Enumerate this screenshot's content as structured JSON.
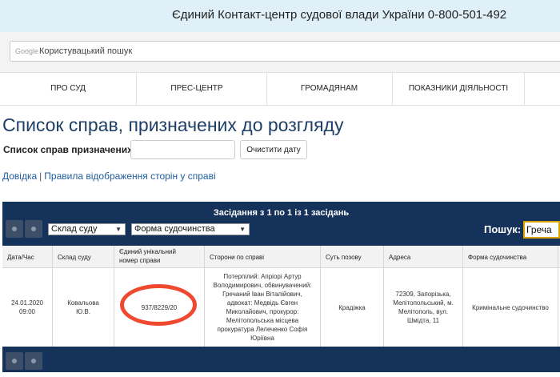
{
  "header": {
    "title": "Єдиний Контакт-центр судової влади України 0-800-501-492"
  },
  "google_search": {
    "logo_text": "Google",
    "placeholder": "Користувацький пошук"
  },
  "nav": {
    "items": [
      {
        "label": "ПРО СУД"
      },
      {
        "label": "ПРЕС-ЦЕНТР"
      },
      {
        "label": "ГРОМАДЯНАМ"
      },
      {
        "label": "ПОКАЗНИКИ ДІЯЛЬНОСТІ"
      }
    ]
  },
  "page": {
    "title": "Список справ, призначених до розгляду",
    "date_label": "Список справ призначених на",
    "date_value": "",
    "clear_date_button": "Очистити дату",
    "links": [
      "Довідка",
      "Правила відображення сторін у справі"
    ]
  },
  "hearings": {
    "count_text": "Засідання з 1 по 1 із 1 засідань",
    "filters": {
      "court_composition": "Склад суду",
      "proceeding_form": "Форма судочинства"
    },
    "search_label": "Пошук:",
    "search_value": "Греча",
    "columns": {
      "date": "Дата/Час",
      "court": "Склад суду",
      "case_number_1": "Єдиний унікальний",
      "case_number_2": "номер справи",
      "parties": "Сторони по справі",
      "claim": "Суть позову",
      "address": "Адреса",
      "form": "Форма судочинства"
    },
    "rows": [
      {
        "date": "24.01.2020",
        "time": "09:00",
        "court_1": "Ковальова",
        "court_2": "Ю.В.",
        "case_number": "937/8229/20",
        "parties": [
          "Потерпілий: Апріорі Артур",
          "Володимирович, обвинувачений:",
          "Гречаний Іван Віталійович,",
          "адвокат: Медвідь Євген",
          "Миколайович, прокурор:",
          "Мелітопольська місцева",
          "прокуратура Лелеченко Софія",
          "Юріївна"
        ],
        "claim": "Крадіжка",
        "address": [
          "72309, Запорізька,",
          "Мелітопольський, м.",
          "Мелітополь, вул.",
          "Шмідта, 11"
        ],
        "form": "Кримінальне судочинство"
      }
    ]
  },
  "colors": {
    "dark_blue": "#15325b",
    "highlight_ring": "#ef4a30",
    "link": "#1f5c99"
  }
}
